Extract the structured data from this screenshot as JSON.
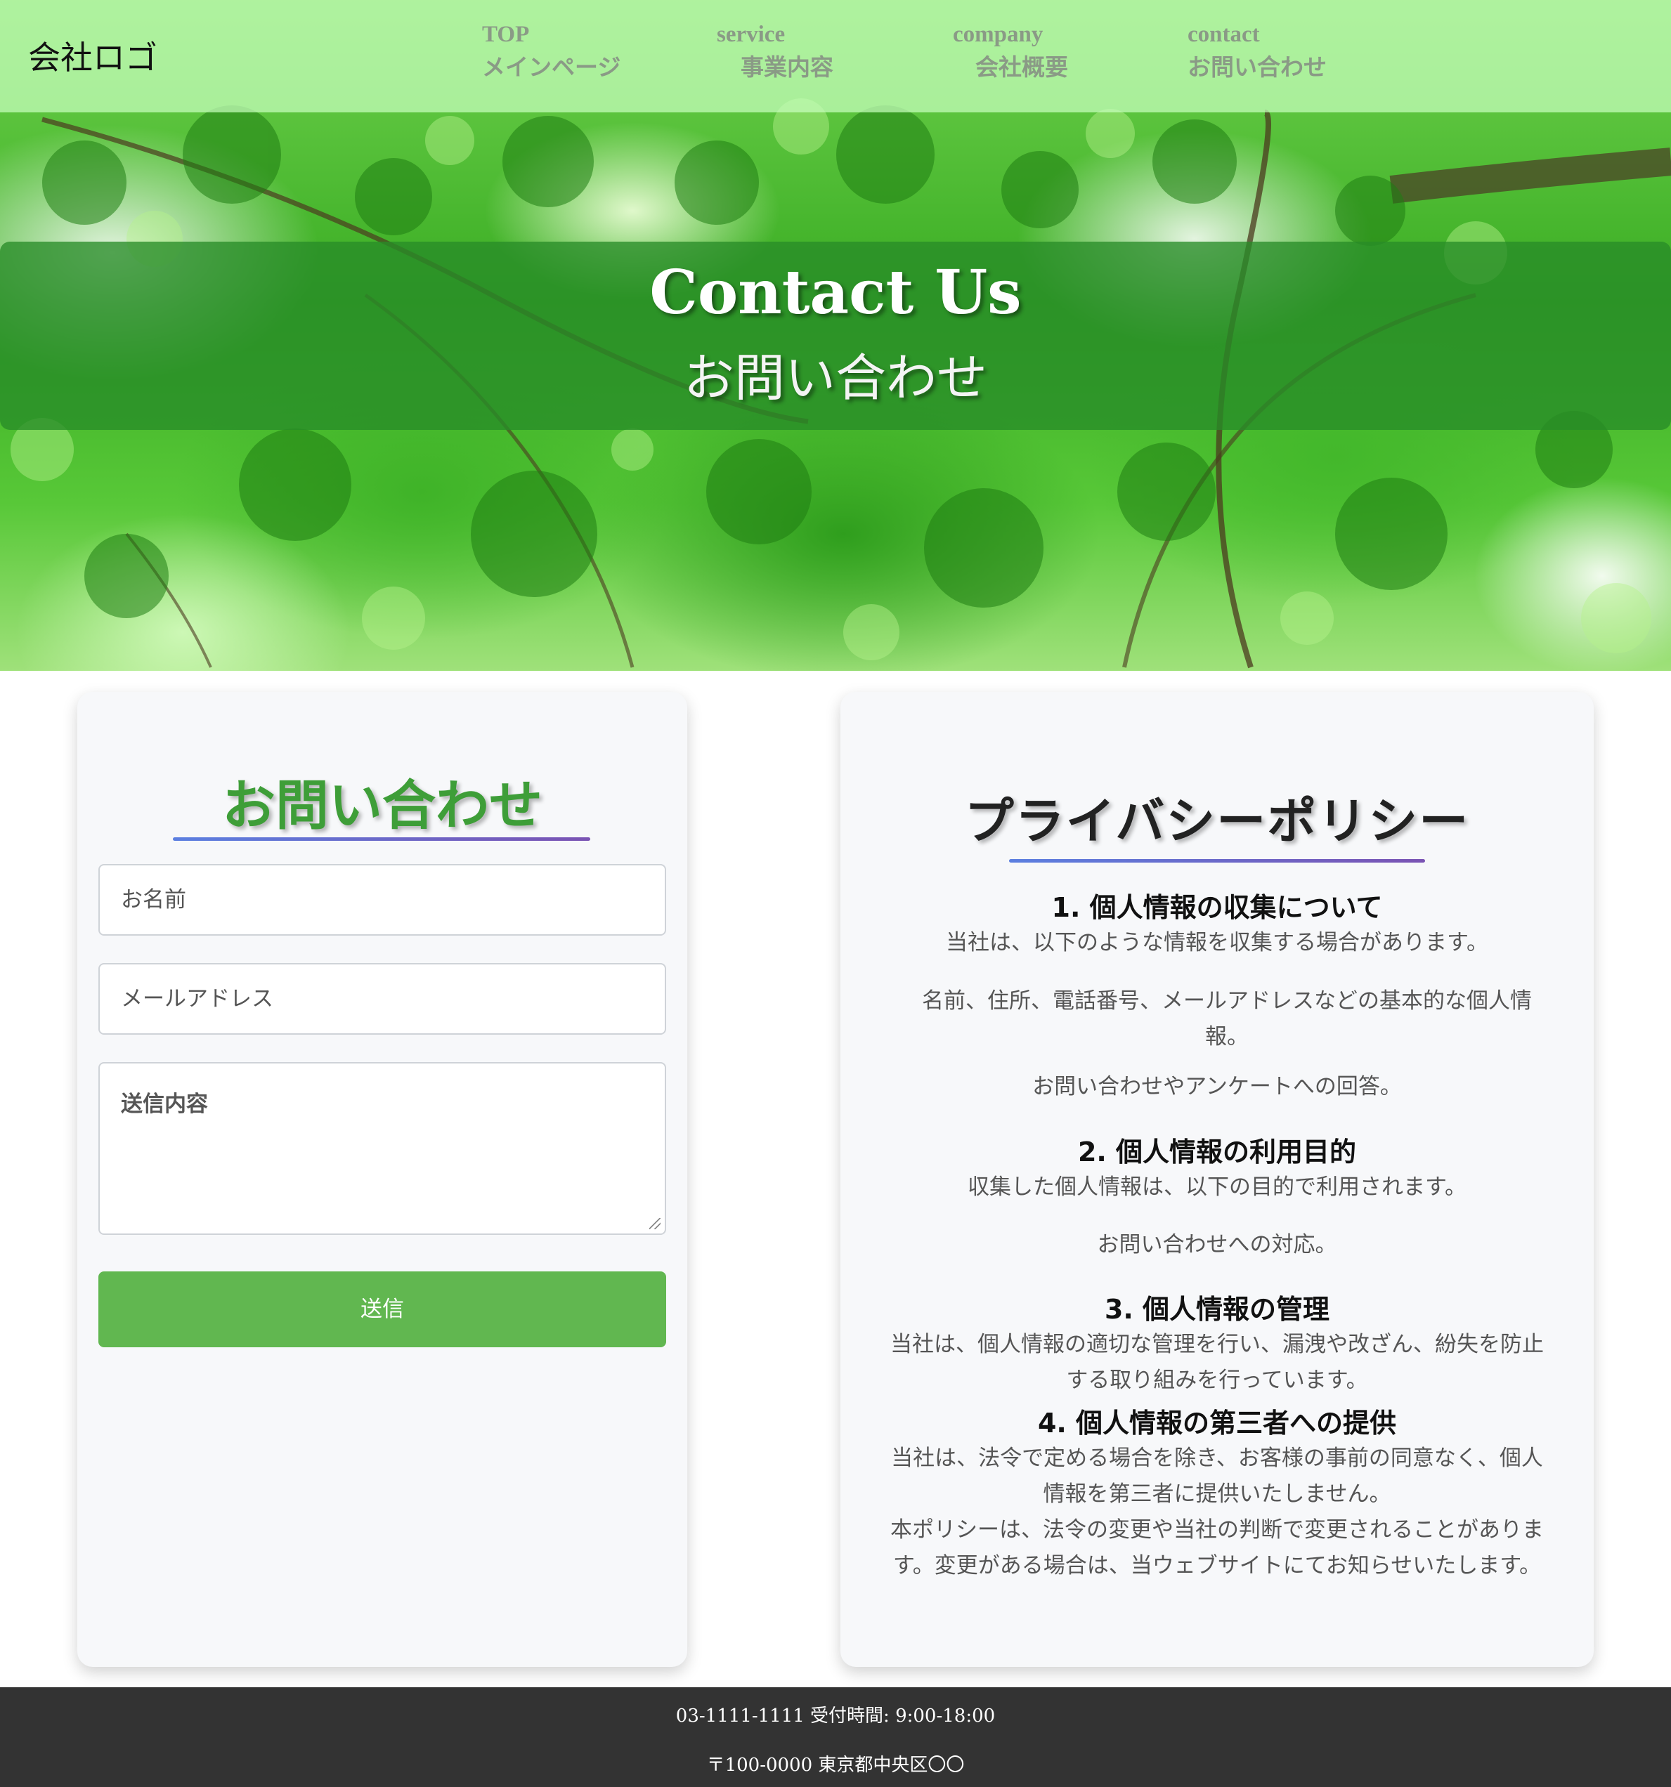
{
  "header": {
    "logo": "会社ロゴ",
    "nav": [
      {
        "en": "TOP",
        "ja": "メインページ"
      },
      {
        "en": "service",
        "ja": "事業内容"
      },
      {
        "en": "company",
        "ja": "会社概要"
      },
      {
        "en": "contact",
        "ja": "お問い合わせ"
      }
    ]
  },
  "hero": {
    "title": "Contact Us",
    "subtitle": "お問い合わせ"
  },
  "form": {
    "heading": "お問い合わせ",
    "name_placeholder": "お名前",
    "email_placeholder": "メールアドレス",
    "message_placeholder": "送信内容",
    "submit_label": "送信"
  },
  "policy": {
    "heading": "プライバシーポリシー",
    "s1_title": "1. 個人情報の収集について",
    "s1_intro": "当社は、以下のような情報を収集する場合があります。",
    "s1_item1": "名前、住所、電話番号、メールアドレスなどの基本的な個人情報。",
    "s1_item2": "お問い合わせやアンケートへの回答。",
    "s2_title": "2. 個人情報の利用目的",
    "s2_intro": "収集した個人情報は、以下の目的で利用されます。",
    "s2_item1": "お問い合わせへの対応。",
    "s3_title": "3. 個人情報の管理",
    "s3_text": "当社は、個人情報の適切な管理を行い、漏洩や改ざん、紛失を防止する取り組みを行っています。",
    "s4_title": "4. 個人情報の第三者への提供",
    "s4_text": "当社は、法令で定める場合を除き、お客様の事前の同意なく、個人情報を第三者に提供いたしません。",
    "closing": "本ポリシーは、法令の変更や当社の判断で変更されることがあります。変更がある場合は、当ウェブサイトにてお知らせいたします。"
  },
  "footer": {
    "phone_hours": "03-1111-1111 受付時間: 9:00-18:00",
    "address": "〒100-0000 東京都中央区〇〇"
  },
  "colors": {
    "accent_green": "#61b750",
    "banner_green": "#288c28",
    "underline_start": "#5b7fe0",
    "underline_end": "#7a53b3",
    "footer_bg": "#333333"
  }
}
